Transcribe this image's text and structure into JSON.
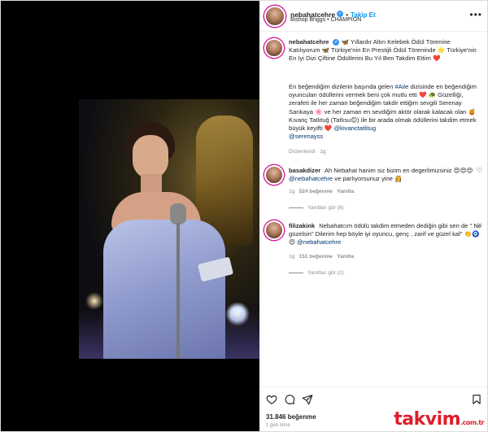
{
  "post": {
    "username": "nebahatcehre",
    "follow_label": "Takip Et",
    "music": "Bishop Briggs • CHAMPION",
    "caption": "🦋 Yıllardır Altın Kelebek Ödül Törenine Katılıyorum 🦋 Türkiye'nin En Prestijli Ödül Töreninde 🌟 Türkiye'nin En İyi Dizi Çiftine Ödüllerini Bu Yıl Ben Takdim Ettim ❤️",
    "caption2_pre": "En beğendiğim dizilerin başında gelen ",
    "caption2_tag": "#Aile",
    "caption2_mid": " dizisinde en beğendiğim oyuncuları ödüllerini vermek beni çok mutlu etti ❤️ 🐢 Güzelliği, zerafeti ile her zaman beğendiğim takdir ettiğim sevgili Serenay Sarıkaya 🌸 ve her zaman en sevdiğim aktör olarak kalacak olan 🍯 Kıvanç Tatlıtuğ (Tatlısu😊) ile bir arada olmak ödüllerini takdim etmek büyük keyifti ❤️ ",
    "caption2_mention1": "@kivanctatlitug",
    "caption2_mention2": "@serenayss",
    "edited": "Düzenlendi · 1g"
  },
  "comments": [
    {
      "username": "basakdizer",
      "text_pre": "Ah Nebahat hanim siz bizim en degerlimizsiniz 😍😍😍 ",
      "mention": "@nebahatcehre",
      "text_post": " ve parlıyorsunuz yine 👸",
      "time": "1g",
      "likes": "524 beğenme",
      "reply": "Yanıtla",
      "view_replies": "Yanıtları gör (6)"
    },
    {
      "username": "filizakink",
      "text_pre": "Nebahatcım ödülü takdim etmeden dediğin gibi sen de \" Ne güzelsin\" Dilerim hep böyle iyi oyuncu, genç , zarif ve güzel kal\" 👏🧿😍 ",
      "mention": "@nebahatcehre",
      "text_post": "",
      "time": "1g",
      "likes": "151 beğenme",
      "reply": "Yanıtla",
      "view_replies": "Yanıtları gör (1)"
    }
  ],
  "footer": {
    "likes": "31.846 beğenme",
    "ago": "1 gün önce",
    "watermark": "takvim",
    "watermark_suffix": ".com.tr"
  },
  "icons": {
    "more": "more-icon",
    "heart": "heart-icon",
    "comment": "comment-icon",
    "share": "share-icon",
    "save": "bookmark-icon"
  },
  "colors": {
    "link": "#00376b",
    "follow": "#0095f6",
    "watermark": "#e11d2a"
  }
}
